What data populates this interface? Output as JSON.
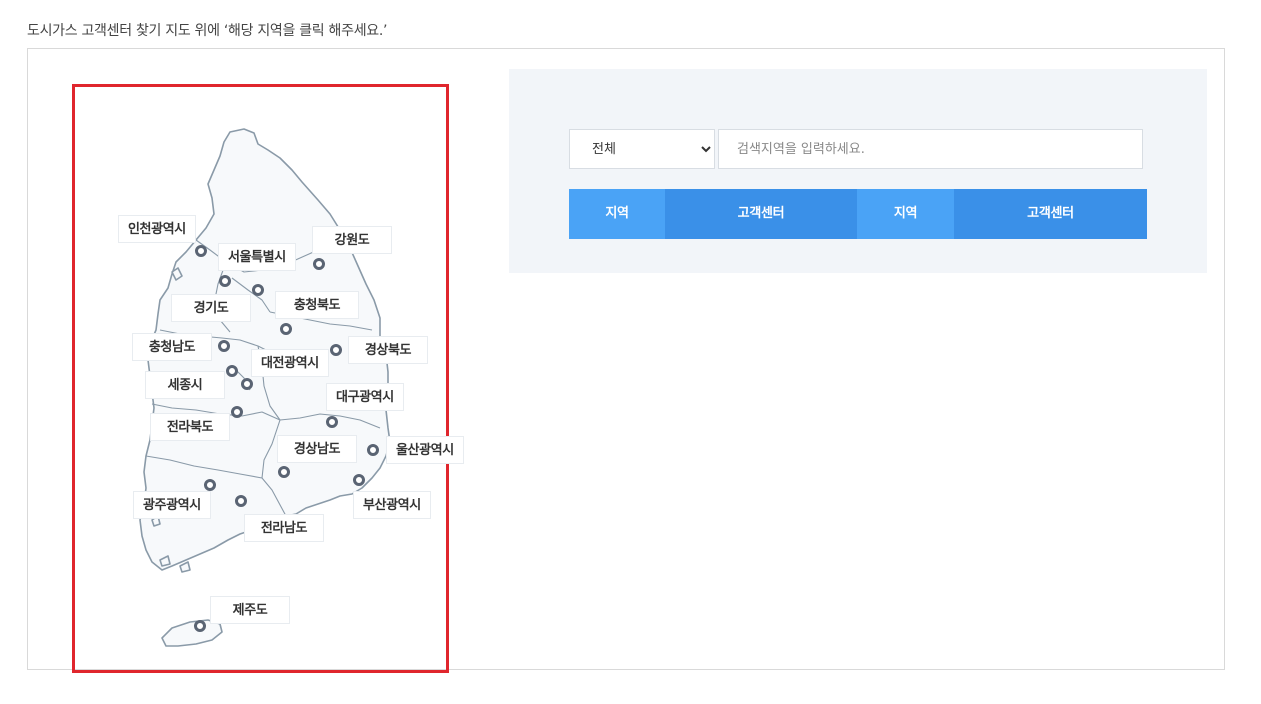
{
  "intro_text": "도시가스 고객센터 찾기 지도 위에 ‘해당 지역을 클릭 해주세요.’",
  "colors": {
    "highlight_border": "#e0262d",
    "panel_bg": "#f2f5f9",
    "header_light": "#4aa3f6",
    "header_dark": "#3a90e8",
    "marker": "#5a6473",
    "map_outline": "#8a9aa8"
  },
  "map": {
    "regions": [
      {
        "name": "인천광역시"
      },
      {
        "name": "서울특별시"
      },
      {
        "name": "강원도"
      },
      {
        "name": "경기도"
      },
      {
        "name": "충청북도"
      },
      {
        "name": "충청남도"
      },
      {
        "name": "대전광역시"
      },
      {
        "name": "경상북도"
      },
      {
        "name": "세종시"
      },
      {
        "name": "대구광역시"
      },
      {
        "name": "전라북도"
      },
      {
        "name": "경상남도"
      },
      {
        "name": "울산광역시"
      },
      {
        "name": "광주광역시"
      },
      {
        "name": "부산광역시"
      },
      {
        "name": "전라남도"
      },
      {
        "name": "제주도"
      }
    ]
  },
  "search": {
    "select_value": "전체",
    "input_placeholder": "검색지역을 입력하세요.",
    "columns": [
      "지역",
      "고객센터",
      "지역",
      "고객센터"
    ]
  }
}
